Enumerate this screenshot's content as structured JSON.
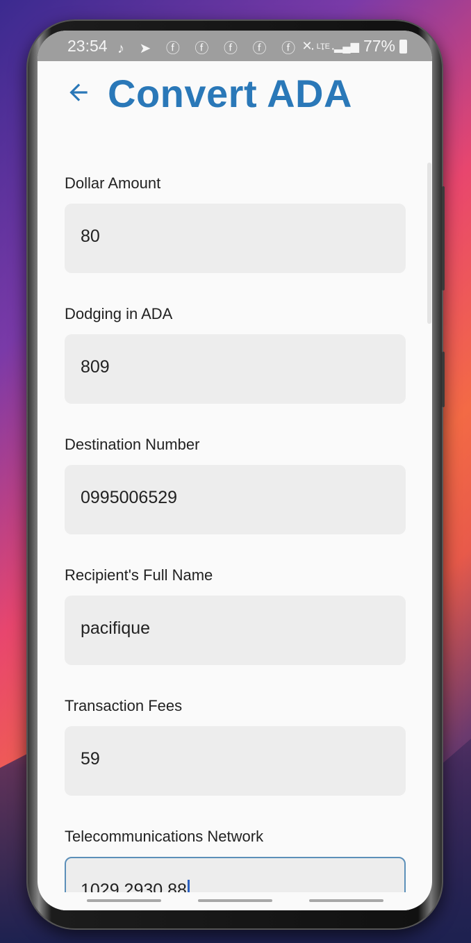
{
  "status_bar": {
    "time": "23:54",
    "notification_icons": "♪ ➤ ⓕ ⓕ ⓕ ⓕ ⓕ ···",
    "network": "LTE",
    "battery": "77%"
  },
  "header": {
    "title": "Convert ADA"
  },
  "form": {
    "fields": [
      {
        "label": "Dollar Amount",
        "value": "80"
      },
      {
        "label": "Dodging in ADA",
        "value": "809"
      },
      {
        "label": "Destination Number",
        "value": "0995006529"
      },
      {
        "label": "Recipient's Full Name",
        "value": "pacifique"
      },
      {
        "label": "Transaction Fees",
        "value": "59"
      },
      {
        "label": "Telecommunications Network",
        "value": "1029 2930 88"
      }
    ]
  },
  "colors": {
    "accent": "#2a78b8",
    "field_bg": "#ededed",
    "focused_border": "#5b8fb9"
  }
}
